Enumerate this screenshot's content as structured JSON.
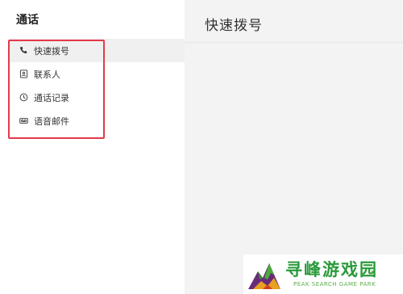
{
  "sidebar": {
    "title": "通话",
    "items": [
      {
        "label": "快速拨号",
        "icon": "phone-icon",
        "active": true
      },
      {
        "label": "联系人",
        "icon": "contact-card-icon",
        "active": false
      },
      {
        "label": "通话记录",
        "icon": "clock-icon",
        "active": false
      },
      {
        "label": "语音邮件",
        "icon": "voicemail-icon",
        "active": false
      }
    ]
  },
  "main": {
    "title": "快速拨号"
  },
  "watermark": {
    "text": "寻峰游戏园",
    "subtext": "PEAK SEARCH GAME PARK"
  },
  "colors": {
    "highlight": "#e23a4a",
    "watermark_green": "#2a9a3a",
    "panel_bg": "#f3f3f3",
    "active_item_bg": "#f0f0f0"
  }
}
